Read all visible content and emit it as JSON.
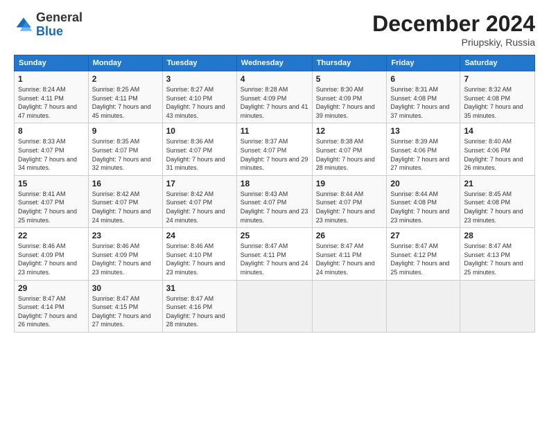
{
  "header": {
    "logo_general": "General",
    "logo_blue": "Blue",
    "month_title": "December 2024",
    "location": "Priupskiy, Russia"
  },
  "weekdays": [
    "Sunday",
    "Monday",
    "Tuesday",
    "Wednesday",
    "Thursday",
    "Friday",
    "Saturday"
  ],
  "weeks": [
    [
      {
        "day": "1",
        "sunrise": "8:24 AM",
        "sunset": "4:11 PM",
        "daylight": "7 hours and 47 minutes."
      },
      {
        "day": "2",
        "sunrise": "8:25 AM",
        "sunset": "4:11 PM",
        "daylight": "7 hours and 45 minutes."
      },
      {
        "day": "3",
        "sunrise": "8:27 AM",
        "sunset": "4:10 PM",
        "daylight": "7 hours and 43 minutes."
      },
      {
        "day": "4",
        "sunrise": "8:28 AM",
        "sunset": "4:09 PM",
        "daylight": "7 hours and 41 minutes."
      },
      {
        "day": "5",
        "sunrise": "8:30 AM",
        "sunset": "4:09 PM",
        "daylight": "7 hours and 39 minutes."
      },
      {
        "day": "6",
        "sunrise": "8:31 AM",
        "sunset": "4:08 PM",
        "daylight": "7 hours and 37 minutes."
      },
      {
        "day": "7",
        "sunrise": "8:32 AM",
        "sunset": "4:08 PM",
        "daylight": "7 hours and 35 minutes."
      }
    ],
    [
      {
        "day": "8",
        "sunrise": "8:33 AM",
        "sunset": "4:07 PM",
        "daylight": "7 hours and 34 minutes."
      },
      {
        "day": "9",
        "sunrise": "8:35 AM",
        "sunset": "4:07 PM",
        "daylight": "7 hours and 32 minutes."
      },
      {
        "day": "10",
        "sunrise": "8:36 AM",
        "sunset": "4:07 PM",
        "daylight": "7 hours and 31 minutes."
      },
      {
        "day": "11",
        "sunrise": "8:37 AM",
        "sunset": "4:07 PM",
        "daylight": "7 hours and 29 minutes."
      },
      {
        "day": "12",
        "sunrise": "8:38 AM",
        "sunset": "4:07 PM",
        "daylight": "7 hours and 28 minutes."
      },
      {
        "day": "13",
        "sunrise": "8:39 AM",
        "sunset": "4:06 PM",
        "daylight": "7 hours and 27 minutes."
      },
      {
        "day": "14",
        "sunrise": "8:40 AM",
        "sunset": "4:06 PM",
        "daylight": "7 hours and 26 minutes."
      }
    ],
    [
      {
        "day": "15",
        "sunrise": "8:41 AM",
        "sunset": "4:07 PM",
        "daylight": "7 hours and 25 minutes."
      },
      {
        "day": "16",
        "sunrise": "8:42 AM",
        "sunset": "4:07 PM",
        "daylight": "7 hours and 24 minutes."
      },
      {
        "day": "17",
        "sunrise": "8:42 AM",
        "sunset": "4:07 PM",
        "daylight": "7 hours and 24 minutes."
      },
      {
        "day": "18",
        "sunrise": "8:43 AM",
        "sunset": "4:07 PM",
        "daylight": "7 hours and 23 minutes."
      },
      {
        "day": "19",
        "sunrise": "8:44 AM",
        "sunset": "4:07 PM",
        "daylight": "7 hours and 23 minutes."
      },
      {
        "day": "20",
        "sunrise": "8:44 AM",
        "sunset": "4:08 PM",
        "daylight": "7 hours and 23 minutes."
      },
      {
        "day": "21",
        "sunrise": "8:45 AM",
        "sunset": "4:08 PM",
        "daylight": "7 hours and 23 minutes."
      }
    ],
    [
      {
        "day": "22",
        "sunrise": "8:46 AM",
        "sunset": "4:09 PM",
        "daylight": "7 hours and 23 minutes."
      },
      {
        "day": "23",
        "sunrise": "8:46 AM",
        "sunset": "4:09 PM",
        "daylight": "7 hours and 23 minutes."
      },
      {
        "day": "24",
        "sunrise": "8:46 AM",
        "sunset": "4:10 PM",
        "daylight": "7 hours and 23 minutes."
      },
      {
        "day": "25",
        "sunrise": "8:47 AM",
        "sunset": "4:11 PM",
        "daylight": "7 hours and 24 minutes."
      },
      {
        "day": "26",
        "sunrise": "8:47 AM",
        "sunset": "4:11 PM",
        "daylight": "7 hours and 24 minutes."
      },
      {
        "day": "27",
        "sunrise": "8:47 AM",
        "sunset": "4:12 PM",
        "daylight": "7 hours and 25 minutes."
      },
      {
        "day": "28",
        "sunrise": "8:47 AM",
        "sunset": "4:13 PM",
        "daylight": "7 hours and 25 minutes."
      }
    ],
    [
      {
        "day": "29",
        "sunrise": "8:47 AM",
        "sunset": "4:14 PM",
        "daylight": "7 hours and 26 minutes."
      },
      {
        "day": "30",
        "sunrise": "8:47 AM",
        "sunset": "4:15 PM",
        "daylight": "7 hours and 27 minutes."
      },
      {
        "day": "31",
        "sunrise": "8:47 AM",
        "sunset": "4:16 PM",
        "daylight": "7 hours and 28 minutes."
      },
      null,
      null,
      null,
      null
    ]
  ]
}
